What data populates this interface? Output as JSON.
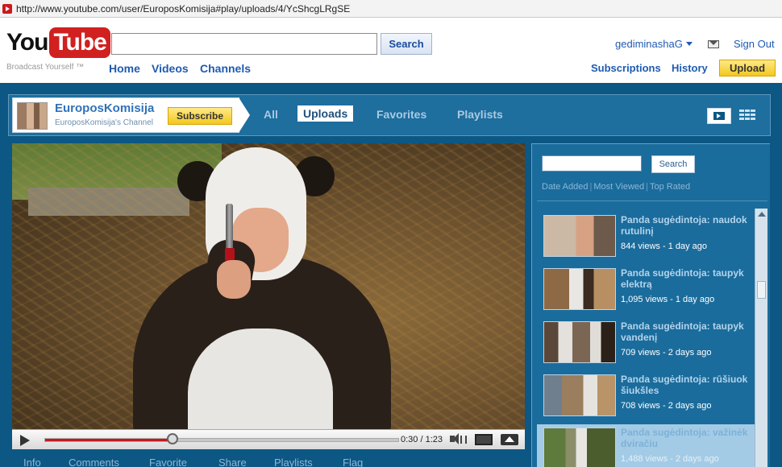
{
  "browser": {
    "url": "http://www.youtube.com/user/EuroposKomisija#play/uploads/4/YcShcgLRgSE"
  },
  "header": {
    "logo_you": "You",
    "logo_tube": "Tube",
    "tagline": "Broadcast Yourself ™",
    "search_value": "",
    "search_button": "Search",
    "nav": [
      "Home",
      "Videos",
      "Channels"
    ],
    "username": "gediminashaG",
    "sign_out": "Sign Out",
    "subscriptions": "Subscriptions",
    "history": "History",
    "upload": "Upload"
  },
  "channel": {
    "name": "EuroposKomisija",
    "subtitle": "EuroposKomisija's Channel",
    "subscribe": "Subscribe",
    "tabs": [
      "All",
      "Uploads",
      "Favorites",
      "Playlists"
    ],
    "active_tab": "Uploads"
  },
  "player": {
    "time": "0:30 / 1:23",
    "progress_fraction": 0.361
  },
  "info_tabs": [
    "Info",
    "Comments",
    "Favorite",
    "Share",
    "Playlists",
    "Flag"
  ],
  "sidebar": {
    "search_value": "",
    "search_button": "Search",
    "sort_links": [
      "Date Added",
      "Most Viewed",
      "Top Rated"
    ],
    "videos": [
      {
        "title": "Panda sugėdintoja: naudok rutulinį",
        "meta": "844 views - 1 day ago"
      },
      {
        "title": "Panda sugėdintoja: taupyk elektrą",
        "meta": "1,095 views - 1 day ago"
      },
      {
        "title": "Panda sugėdintoja: taupyk vandenį",
        "meta": "709 views - 2 days ago"
      },
      {
        "title": "Panda sugėdintoja: rūšiuok šiukšles",
        "meta": "708 views - 2 days ago"
      },
      {
        "title": "Panda sugėdintoja: važinėk dviračiu",
        "meta": "1,488 views - 2 days ago"
      }
    ],
    "selected_index": 4
  },
  "colors": {
    "accent_blue": "#0c5784",
    "youtube_red": "#d0201f",
    "upload_yellow": "#f3c81e"
  }
}
